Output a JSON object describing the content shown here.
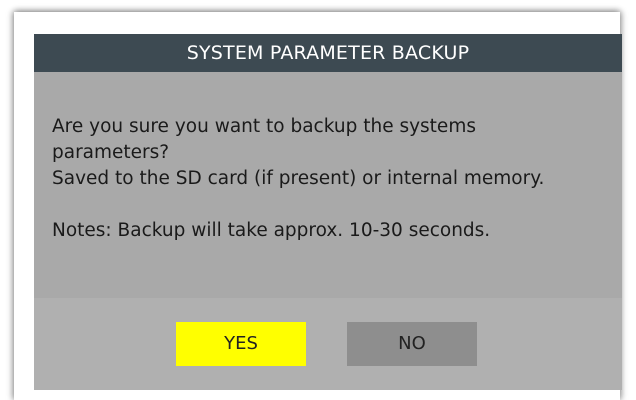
{
  "dialog": {
    "title": "SYSTEM PARAMETER BACKUP",
    "message_lines": [
      "Are you sure you want to backup the systems",
      "parameters?",
      "Saved to the SD card (if present) or internal memory."
    ],
    "note": "Notes: Backup will take approx. 10-30 seconds.",
    "yes_label": "YES",
    "no_label": "NO"
  },
  "colors": {
    "title_bar": "#3d4a52",
    "dialog_background": "#a9a9a9",
    "yes_button": "#ffff00",
    "no_button": "#8e8e8e"
  }
}
